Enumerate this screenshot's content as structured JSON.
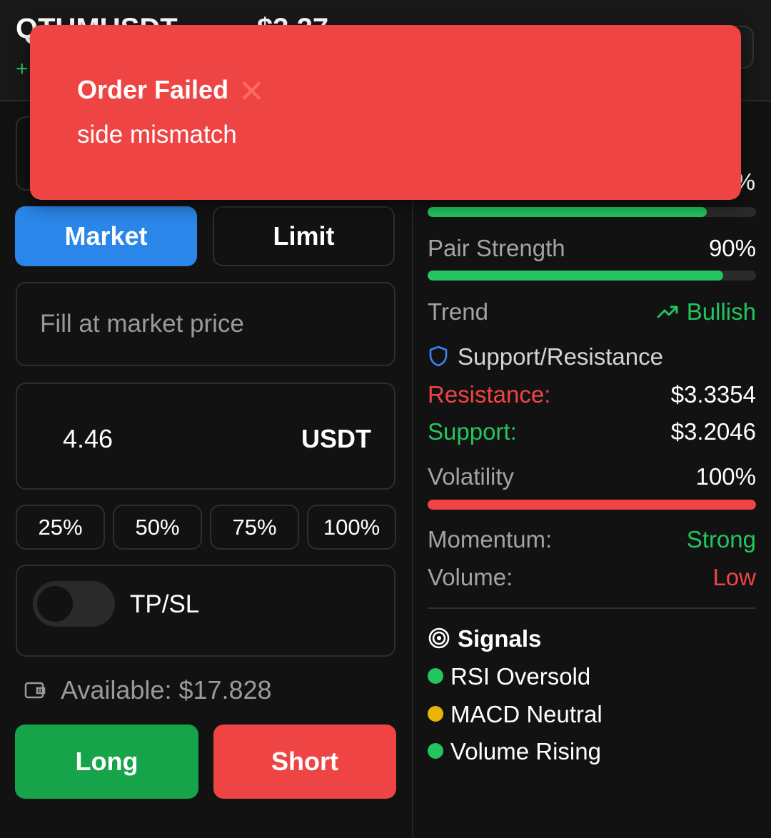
{
  "header": {
    "pair": "QTUMUSDT",
    "price": "$3.27",
    "change": "+"
  },
  "order_types": {
    "market": "Market",
    "limit": "Limit"
  },
  "price_field": {
    "placeholder": "Fill at market price"
  },
  "amount": {
    "value": "4.46",
    "unit": "USDT"
  },
  "percent_buttons": [
    "25%",
    "50%",
    "75%",
    "100%"
  ],
  "tpsl": {
    "label": "TP/SL",
    "enabled": false
  },
  "available": {
    "text": "Available: $17.828"
  },
  "actions": {
    "long": "Long",
    "short": "Short"
  },
  "analysis": {
    "top_bar": {
      "value": "%",
      "fill_percent": 85,
      "color": "#22c55e"
    },
    "pair_strength": {
      "label": "Pair Strength",
      "value": "90%",
      "fill_percent": 90,
      "color": "#22c55e"
    },
    "trend": {
      "label": "Trend",
      "value": "Bullish",
      "icon": "trending-up-icon",
      "color": "#22c55e"
    },
    "support_resistance": {
      "title": "Support/Resistance",
      "icon": "shield-icon",
      "resistance_label": "Resistance:",
      "resistance_value": "$3.3354",
      "support_label": "Support:",
      "support_value": "$3.2046"
    },
    "volatility": {
      "label": "Volatility",
      "value": "100%",
      "fill_percent": 100,
      "color": "#ef4444"
    },
    "momentum": {
      "label": "Momentum:",
      "value": "Strong",
      "color": "#22c55e"
    },
    "volume": {
      "label": "Volume:",
      "value": "Low",
      "color": "#ef4444"
    },
    "signals": {
      "title": "Signals",
      "icon": "target-icon",
      "items": [
        {
          "label": "RSI Oversold",
          "color": "#22c55e"
        },
        {
          "label": "MACD Neutral",
          "color": "#eab308"
        },
        {
          "label": "Volume Rising",
          "color": "#22c55e"
        }
      ]
    }
  },
  "toast": {
    "title": "Order Failed",
    "icon": "cross-mark-icon",
    "message": "side mismatch",
    "color": "#ef4444"
  }
}
